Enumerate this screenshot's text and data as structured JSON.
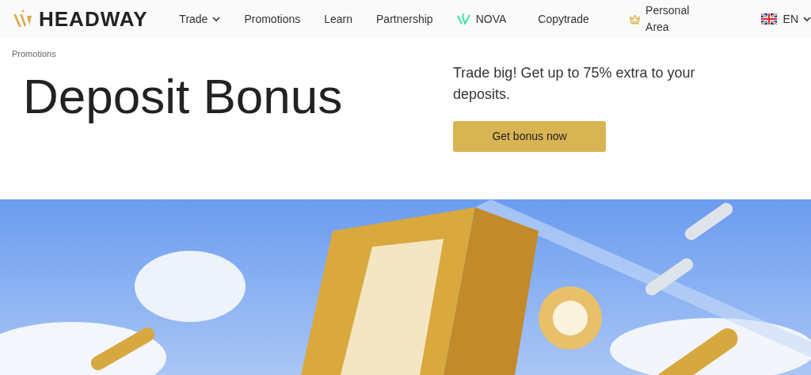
{
  "logo": {
    "text": "HEADWAY"
  },
  "nav": [
    {
      "label": "Trade",
      "kind": "dropdown"
    },
    {
      "label": "Promotions",
      "kind": "plain"
    },
    {
      "label": "Learn",
      "kind": "plain"
    },
    {
      "label": "Partnership",
      "kind": "plain"
    },
    {
      "label": "NOVA",
      "kind": "nova"
    },
    {
      "label": "Copytrade",
      "kind": "plain"
    },
    {
      "label": "Personal Area",
      "kind": "account"
    }
  ],
  "language": {
    "label": "EN"
  },
  "breadcrumb": "Promotions",
  "title": "Deposit Bonus",
  "tagline": "Trade big! Get up to 75% extra to your deposits.",
  "cta": "Get bonus now"
}
